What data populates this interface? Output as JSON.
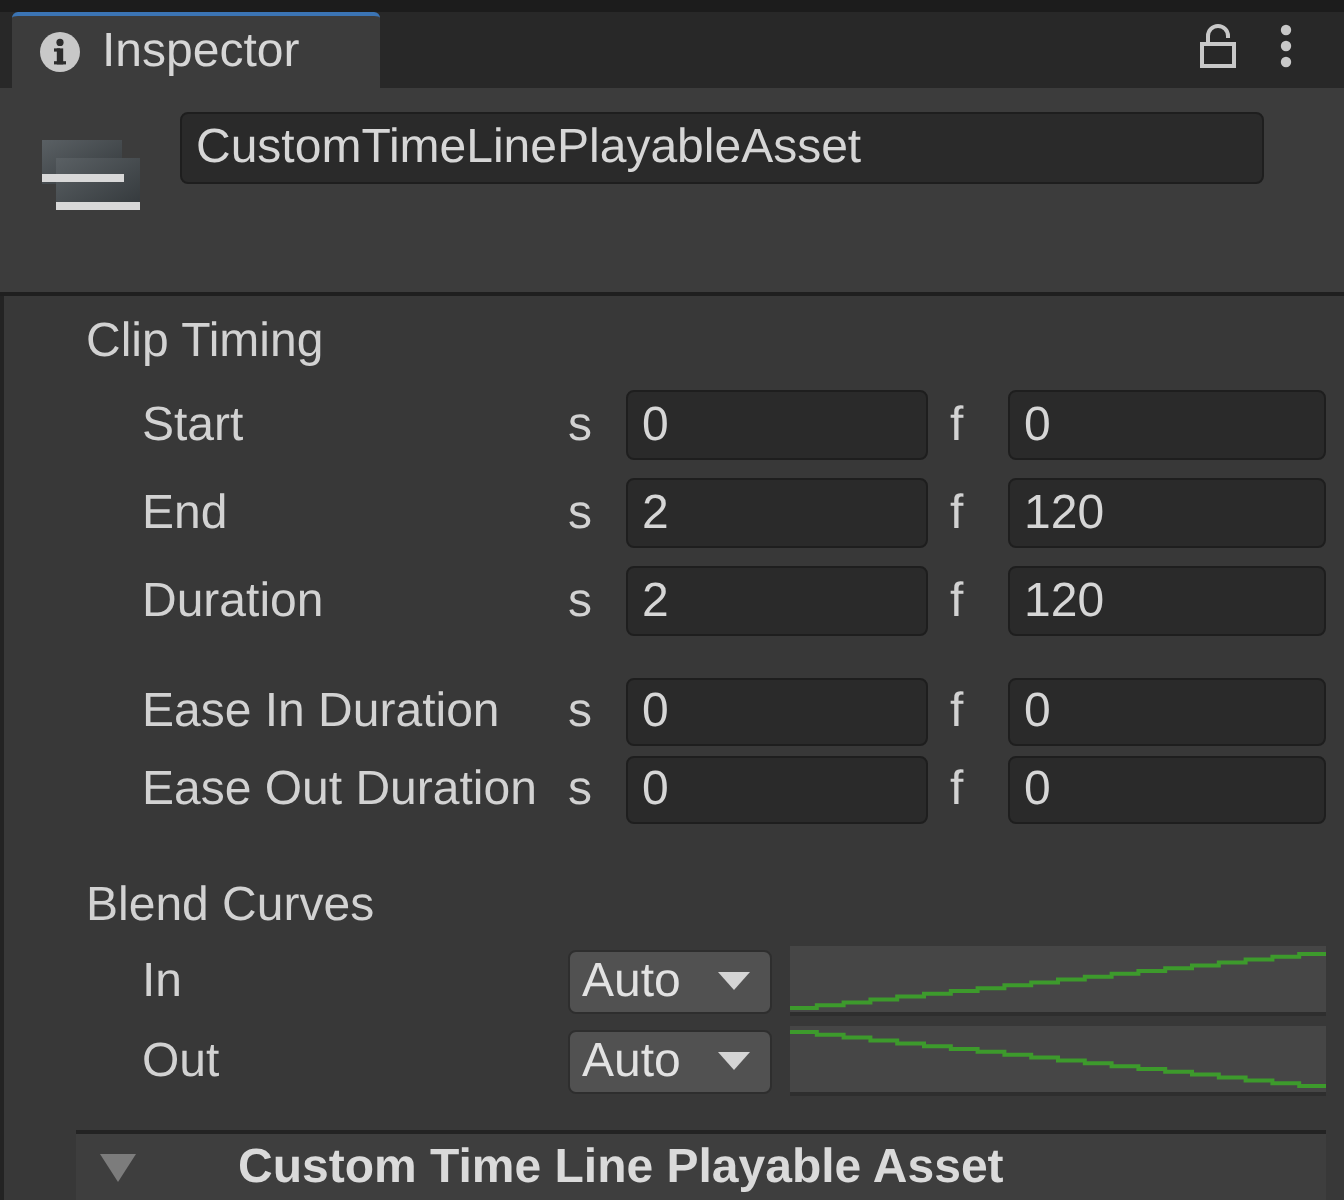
{
  "window": {
    "tab": {
      "label": "Inspector",
      "selected": true
    },
    "locked": false
  },
  "header": {
    "name_field": {
      "value": "CustomTimeLinePlayableAsset"
    }
  },
  "clip_timing": {
    "title": "Clip Timing",
    "groups": [
      {
        "rows": [
          {
            "label": "Start",
            "seconds_unit": "s",
            "seconds": "0",
            "frames_unit": "f",
            "frames": "0"
          },
          {
            "label": "End",
            "seconds_unit": "s",
            "seconds": "2",
            "frames_unit": "f",
            "frames": "120"
          },
          {
            "label": "Duration",
            "seconds_unit": "s",
            "seconds": "2",
            "frames_unit": "f",
            "frames": "120"
          }
        ]
      },
      {
        "rows": [
          {
            "label": "Ease In Duration",
            "seconds_unit": "s",
            "seconds": "0",
            "frames_unit": "f",
            "frames": "0"
          },
          {
            "label": "Ease Out Duration",
            "seconds_unit": "s",
            "seconds": "0",
            "frames_unit": "f",
            "frames": "0"
          }
        ]
      }
    ]
  },
  "blend_curves": {
    "title": "Blend Curves",
    "rows": [
      {
        "label": "In",
        "dropdown": "Auto",
        "kind": "rising"
      },
      {
        "label": "Out",
        "dropdown": "Auto",
        "kind": "falling"
      }
    ]
  },
  "foldout": {
    "title": "Custom Time Line Playable Asset",
    "expanded": true
  }
}
